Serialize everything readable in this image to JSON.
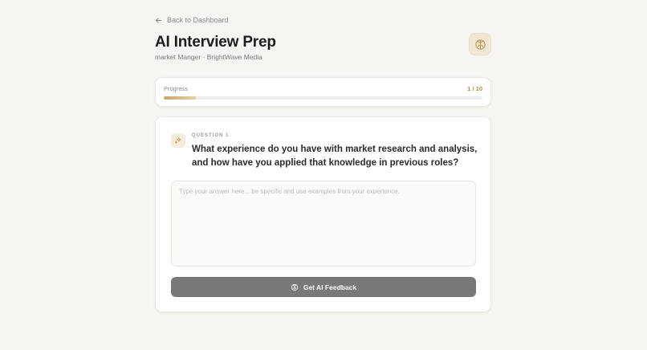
{
  "nav": {
    "back_label": "Back to Dashboard",
    "back_icon": "arrow-left-icon"
  },
  "header": {
    "title": "AI Interview Prep",
    "subtitle": "market Manger · BrightWave Media",
    "action_icon": "brain-icon"
  },
  "progress": {
    "label": "Progress",
    "current": 1,
    "total": 10,
    "count_text": "1 / 10",
    "fraction": 0.1
  },
  "question": {
    "label": "QUESTION 1",
    "icon": "sparkles-icon",
    "text": "What experience do you have with market research and analysis, and how have you applied that knowledge in previous roles?"
  },
  "answer": {
    "value": "",
    "placeholder": "Type your answer here... be specific and use examples from your experience."
  },
  "feedback_button": {
    "label": "Get AI Feedback",
    "icon": "brain-icon"
  },
  "colors": {
    "background": "#f6f5f2",
    "accent": "#c7a86a",
    "accent_text": "#a88a4a",
    "button": "#787878"
  }
}
